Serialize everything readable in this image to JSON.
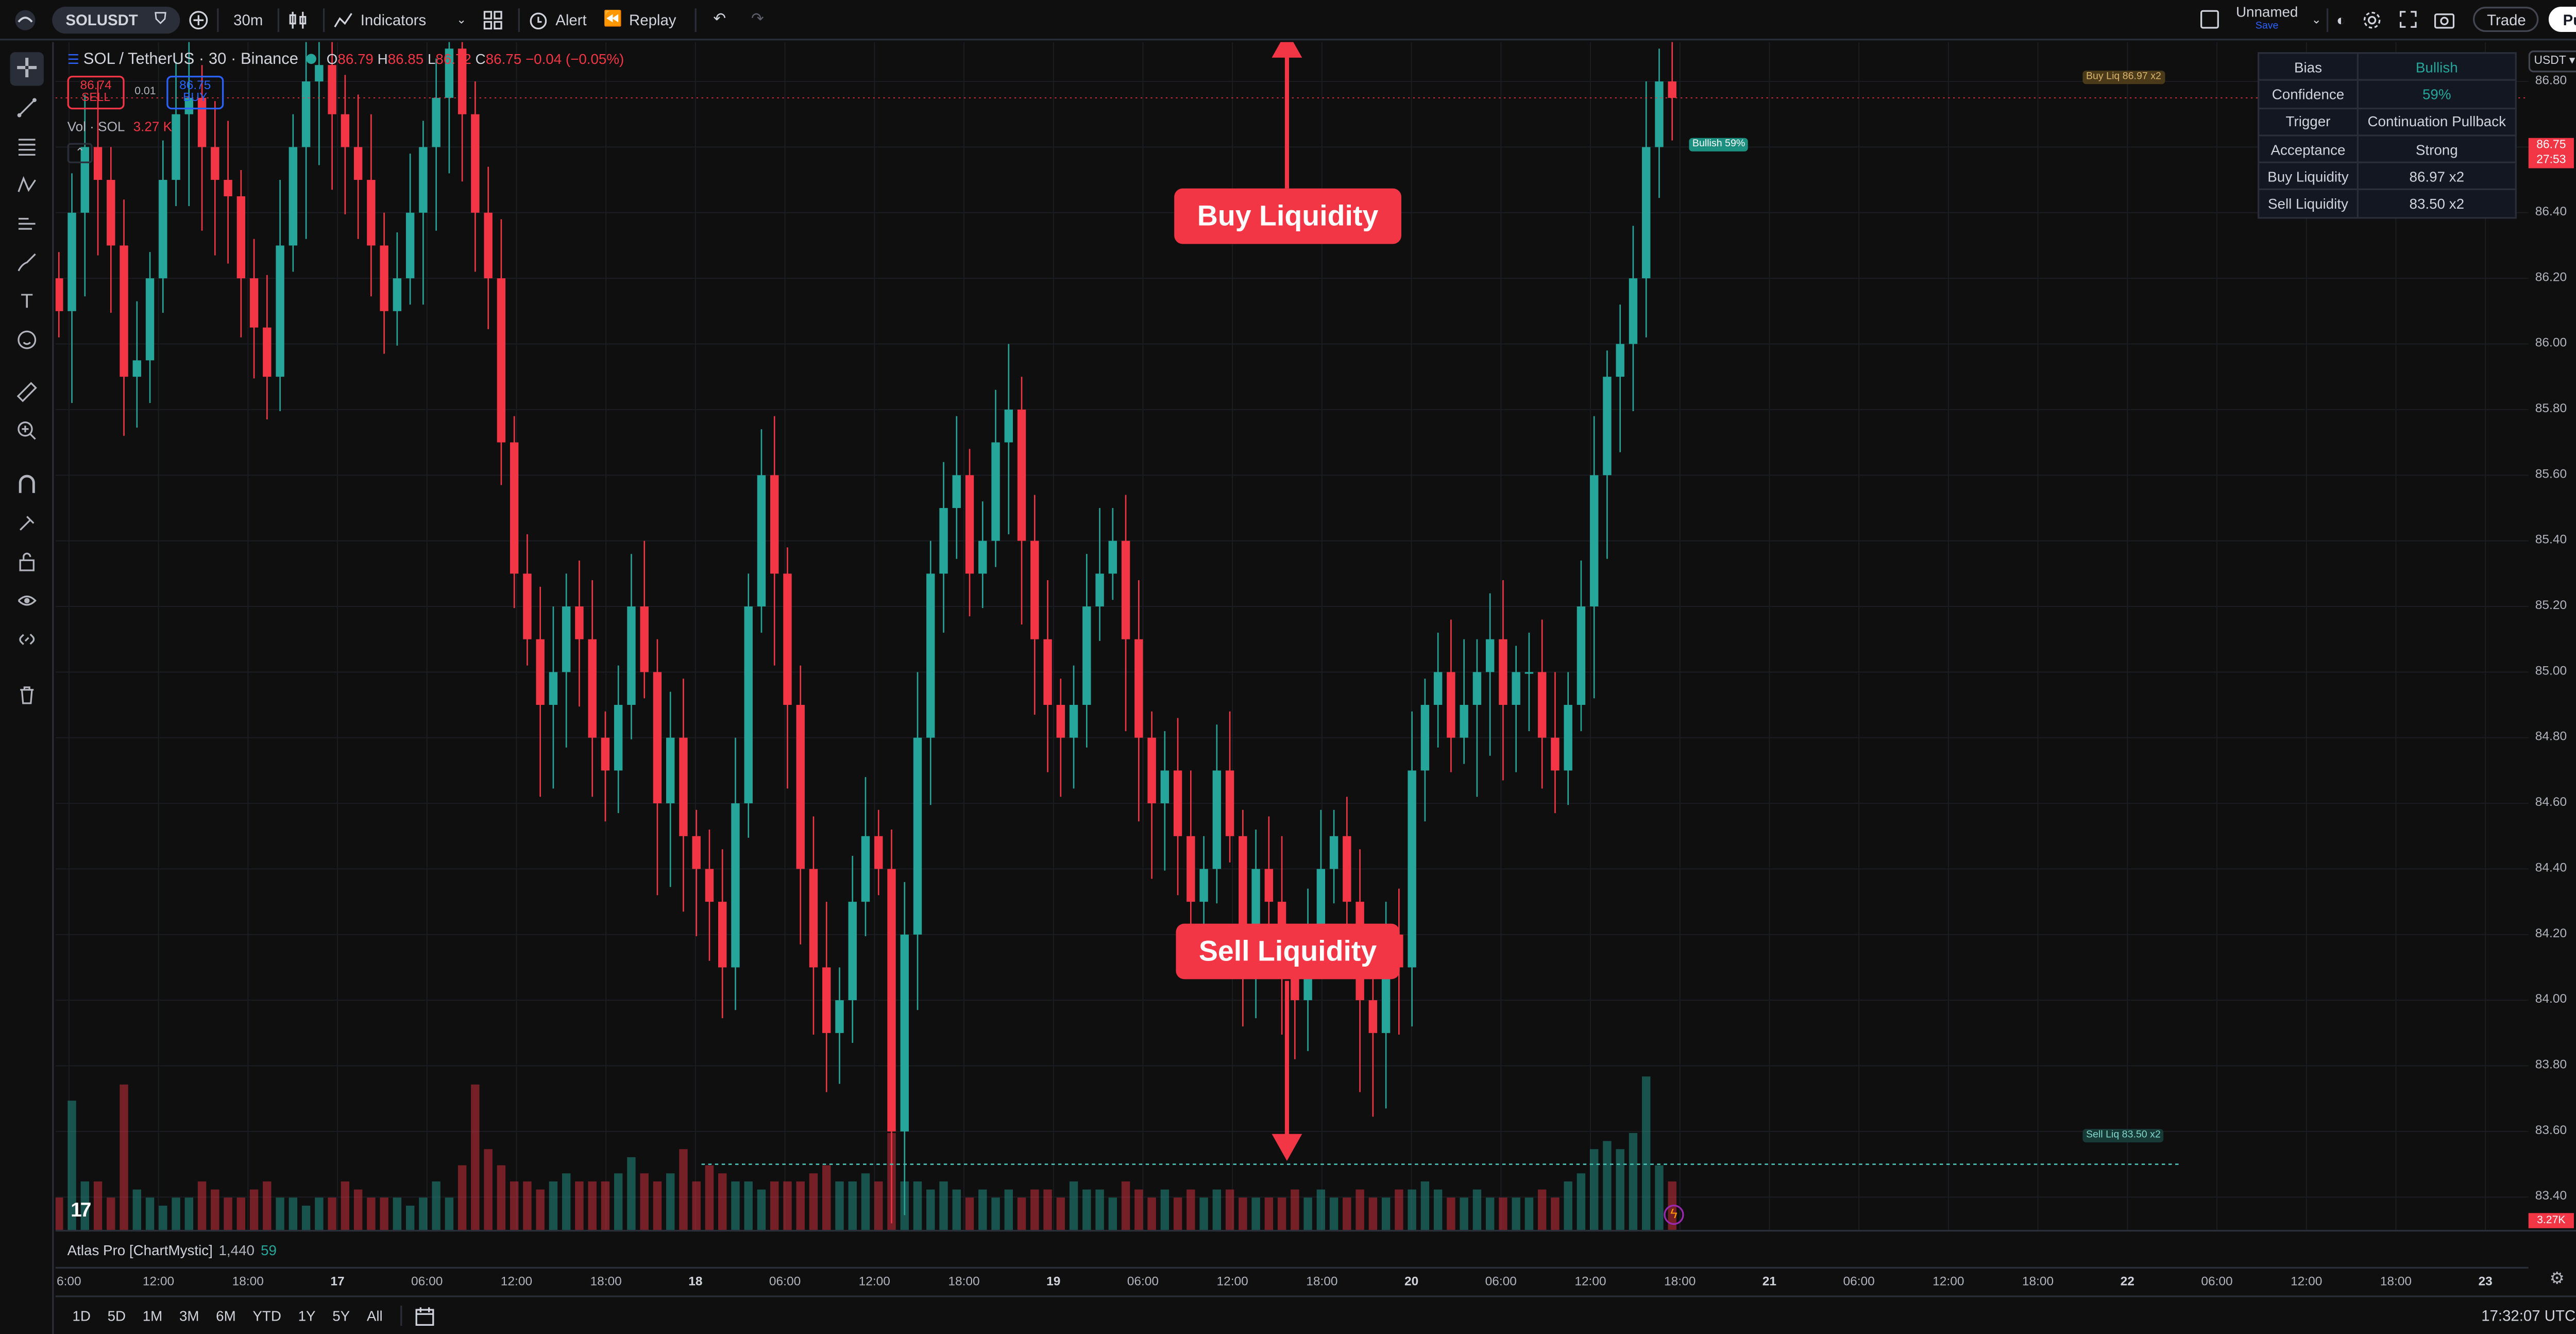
{
  "topbar": {
    "symbol": "SOLUSDT",
    "interval": "30m",
    "indicators_label": "Indicators",
    "alert_label": "Alert",
    "replay_label": "Replay",
    "layout_name": "Unnamed",
    "layout_status": "Save",
    "trade_label": "Trade",
    "publish_label": "Publish"
  },
  "legend": {
    "title": "SOL / TetherUS · 30 · Binance",
    "o_label": "O",
    "o": "86.79",
    "h_label": "H",
    "h": "86.85",
    "l_label": "L",
    "l": "86.72",
    "c_label": "C",
    "c": "86.75",
    "change": "−0.04 (−0.05%)",
    "sell_price": "86.74",
    "sell_label": "SELL",
    "spread": "0.01",
    "buy_price": "86.75",
    "buy_label": "BUY",
    "vol_label": "Vol · SOL",
    "vol_value": "3.27 K"
  },
  "info_table": {
    "rows": [
      {
        "key": "Bias",
        "value": "Bullish",
        "color": "#26a69a"
      },
      {
        "key": "Confidence",
        "value": "59%",
        "color": "#26a69a"
      },
      {
        "key": "Trigger",
        "value": "Continuation Pullback",
        "color": "#d1d4dc"
      },
      {
        "key": "Acceptance",
        "value": "Strong",
        "color": "#d1d4dc"
      },
      {
        "key": "Buy Liquidity",
        "value": "86.97 x2",
        "color": "#d1d4dc"
      },
      {
        "key": "Sell Liquidity",
        "value": "83.50 x2",
        "color": "#d1d4dc"
      }
    ]
  },
  "annotations": {
    "buy_callout": "Buy Liquidity",
    "sell_callout": "Sell Liquidity",
    "buy_line_label": "Buy Liq 86.97 x2",
    "sell_line_label": "Sell Liq 83.50 x2",
    "bullish_tag": "Bullish 59%"
  },
  "price_axis": {
    "currency": "USDT",
    "ticks": [
      "86.80",
      "86.60",
      "86.40",
      "86.20",
      "86.00",
      "85.80",
      "85.60",
      "85.40",
      "85.20",
      "85.00",
      "84.80",
      "84.60",
      "84.40",
      "84.20",
      "84.00",
      "83.80",
      "83.60",
      "83.40"
    ],
    "last_price": "86.75",
    "countdown": "27:53",
    "volume_tag": "3.27K"
  },
  "time_axis": {
    "ticks": [
      "6:00",
      "12:00",
      "18:00",
      "17",
      "06:00",
      "12:00",
      "18:00",
      "18",
      "06:00",
      "12:00",
      "18:00",
      "19",
      "06:00",
      "12:00",
      "18:00",
      "20",
      "06:00",
      "12:00",
      "18:00",
      "21",
      "06:00",
      "12:00",
      "18:00",
      "22",
      "06:00",
      "12:00",
      "18:00",
      "23"
    ]
  },
  "indicator_pane": {
    "name": "Atlas Pro [ChartMystic]",
    "value1": "1,440",
    "value2": "59"
  },
  "bottom_bar": {
    "ranges": [
      "1D",
      "5D",
      "1M",
      "3M",
      "6M",
      "YTD",
      "1Y",
      "5Y",
      "All"
    ],
    "clock": "17:32:07 UTC"
  },
  "colors": {
    "up": "#26a69a",
    "down": "#f23645",
    "background": "#0f0f0f",
    "accent": "#2962ff"
  },
  "chart_data": {
    "type": "candlestick",
    "symbol": "SOL / TetherUS",
    "interval": "30",
    "ylim": [
      83.3,
      86.92
    ],
    "buy_liquidity": 86.97,
    "sell_liquidity": 83.5,
    "last_price": 86.75,
    "close_series": [
      86.1,
      86.4,
      86.6,
      86.5,
      86.3,
      85.9,
      85.95,
      86.2,
      86.5,
      86.7,
      86.75,
      86.6,
      86.5,
      86.45,
      86.2,
      86.05,
      85.9,
      86.3,
      86.6,
      86.8,
      86.85,
      86.7,
      86.6,
      86.5,
      86.3,
      86.1,
      86.2,
      86.4,
      86.6,
      86.75,
      86.9,
      86.7,
      86.4,
      86.2,
      85.7,
      85.3,
      85.1,
      84.9,
      85.0,
      85.2,
      85.1,
      84.8,
      84.7,
      84.9,
      85.2,
      85.0,
      84.6,
      84.8,
      84.5,
      84.4,
      84.3,
      84.1,
      84.6,
      85.2,
      85.6,
      85.3,
      84.9,
      84.4,
      84.1,
      83.9,
      84.0,
      84.3,
      84.5,
      84.4,
      83.6,
      84.2,
      84.8,
      85.3,
      85.5,
      85.6,
      85.3,
      85.4,
      85.7,
      85.8,
      85.4,
      85.1,
      84.9,
      84.8,
      84.9,
      85.2,
      85.3,
      85.4,
      85.1,
      84.8,
      84.6,
      84.7,
      84.5,
      84.3,
      84.4,
      84.7,
      84.5,
      84.2,
      84.4,
      84.3,
      84.1,
      84.0,
      84.2,
      84.4,
      84.5,
      84.3,
      84.0,
      83.9,
      84.2,
      84.1,
      84.7,
      84.9,
      85.0,
      84.8,
      84.9,
      85.0,
      85.1,
      84.9,
      85.0,
      85.0,
      84.8,
      84.7,
      84.9,
      85.2,
      85.6,
      85.9,
      86.0,
      86.2,
      86.6,
      86.8,
      86.75
    ],
    "volume_relative": [
      0.2,
      0.8,
      0.3,
      0.3,
      0.2,
      0.9,
      0.25,
      0.2,
      0.15,
      0.2,
      0.2,
      0.3,
      0.25,
      0.2,
      0.2,
      0.25,
      0.3,
      0.2,
      0.2,
      0.15,
      0.2,
      0.2,
      0.3,
      0.25,
      0.2,
      0.2,
      0.2,
      0.15,
      0.2,
      0.3,
      0.2,
      0.4,
      0.9,
      0.5,
      0.4,
      0.3,
      0.3,
      0.25,
      0.3,
      0.35,
      0.3,
      0.3,
      0.3,
      0.35,
      0.45,
      0.35,
      0.3,
      0.35,
      0.5,
      0.3,
      0.4,
      0.35,
      0.3,
      0.3,
      0.25,
      0.3,
      0.3,
      0.3,
      0.35,
      0.4,
      0.3,
      0.3,
      0.35,
      0.3,
      0.6,
      0.3,
      0.3,
      0.25,
      0.3,
      0.25,
      0.2,
      0.25,
      0.2,
      0.25,
      0.2,
      0.25,
      0.25,
      0.2,
      0.3,
      0.25,
      0.25,
      0.2,
      0.3,
      0.25,
      0.2,
      0.25,
      0.2,
      0.25,
      0.2,
      0.25,
      0.25,
      0.2,
      0.2,
      0.2,
      0.2,
      0.25,
      0.2,
      0.25,
      0.2,
      0.2,
      0.25,
      0.2,
      0.2,
      0.25,
      0.25,
      0.3,
      0.25,
      0.2,
      0.2,
      0.25,
      0.2,
      0.2,
      0.2,
      0.2,
      0.25,
      0.2,
      0.3,
      0.35,
      0.5,
      0.55,
      0.5,
      0.6,
      0.95,
      0.4,
      0.3
    ]
  }
}
